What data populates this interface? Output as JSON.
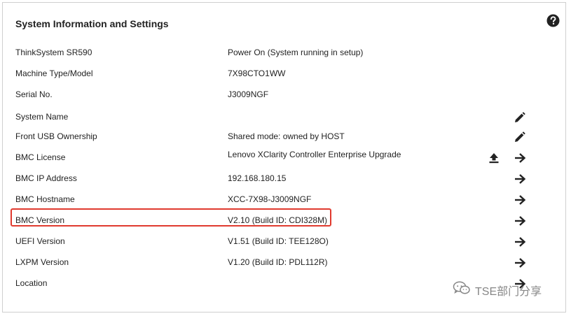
{
  "panel": {
    "title": "System Information and Settings",
    "help_icon": "help-circle-icon"
  },
  "rows": [
    {
      "label": "ThinkSystem SR590",
      "value": "Power On (System running in setup)",
      "actions": []
    },
    {
      "label": "Machine Type/Model",
      "value": "7X98CTO1WW",
      "actions": []
    },
    {
      "label": "Serial No.",
      "value": "J3009NGF",
      "actions": []
    },
    {
      "label": "System Name",
      "value": "",
      "actions": [
        "pencil-icon"
      ]
    },
    {
      "label": "Front USB Ownership",
      "value": "Shared mode: owned by HOST",
      "actions": [
        "pencil-icon"
      ]
    },
    {
      "label": "BMC License",
      "value": "Lenovo XClarity Controller Enterprise Upgrade",
      "actions": [
        "upload-icon",
        "arrow-right-icon"
      ]
    },
    {
      "label": "BMC IP Address",
      "value": "192.168.180.15",
      "actions": [
        "arrow-right-icon"
      ]
    },
    {
      "label": "BMC Hostname",
      "value": "XCC-7X98-J3009NGF",
      "actions": [
        "arrow-right-icon"
      ]
    },
    {
      "label": "BMC Version",
      "value": "V2.10 (Build ID: CDI328M)",
      "actions": [
        "arrow-right-icon"
      ],
      "highlighted": true
    },
    {
      "label": "UEFI Version",
      "value": "V1.51 (Build ID: TEE128O)",
      "actions": [
        "arrow-right-icon"
      ]
    },
    {
      "label": "LXPM Version",
      "value": "V1.20 (Build ID: PDL112R)",
      "actions": [
        "arrow-right-icon"
      ]
    },
    {
      "label": "Location",
      "value": "",
      "actions": [
        "arrow-right-icon"
      ]
    }
  ],
  "highlight_color": "#e03a2e",
  "watermark": {
    "icon": "wechat-icon",
    "text": "TSE部门分享"
  }
}
